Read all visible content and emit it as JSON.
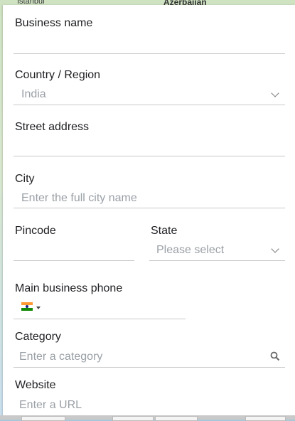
{
  "map": {
    "labels": [
      "İstanbul",
      "Azerbaijan"
    ]
  },
  "form": {
    "business_name": {
      "label": "Business name",
      "value": ""
    },
    "country": {
      "label": "Country / Region",
      "value": "India"
    },
    "street": {
      "label": "Street address",
      "value": ""
    },
    "city": {
      "label": "City",
      "placeholder": "Enter the full city name"
    },
    "pincode": {
      "label": "Pincode",
      "value": ""
    },
    "state": {
      "label": "State",
      "placeholder": "Please select"
    },
    "phone": {
      "label": "Main business phone",
      "flag": "india-flag-icon",
      "value": ""
    },
    "category": {
      "label": "Category",
      "placeholder": "Enter a category"
    },
    "website": {
      "label": "Website",
      "placeholder": "Enter a URL"
    }
  },
  "colors": {
    "label": "#202124",
    "placeholder": "#9aa0a6",
    "underline": "#c8c8c8",
    "flag_saffron": "#ff9933",
    "flag_white": "#ffffff",
    "flag_green": "#138808"
  }
}
